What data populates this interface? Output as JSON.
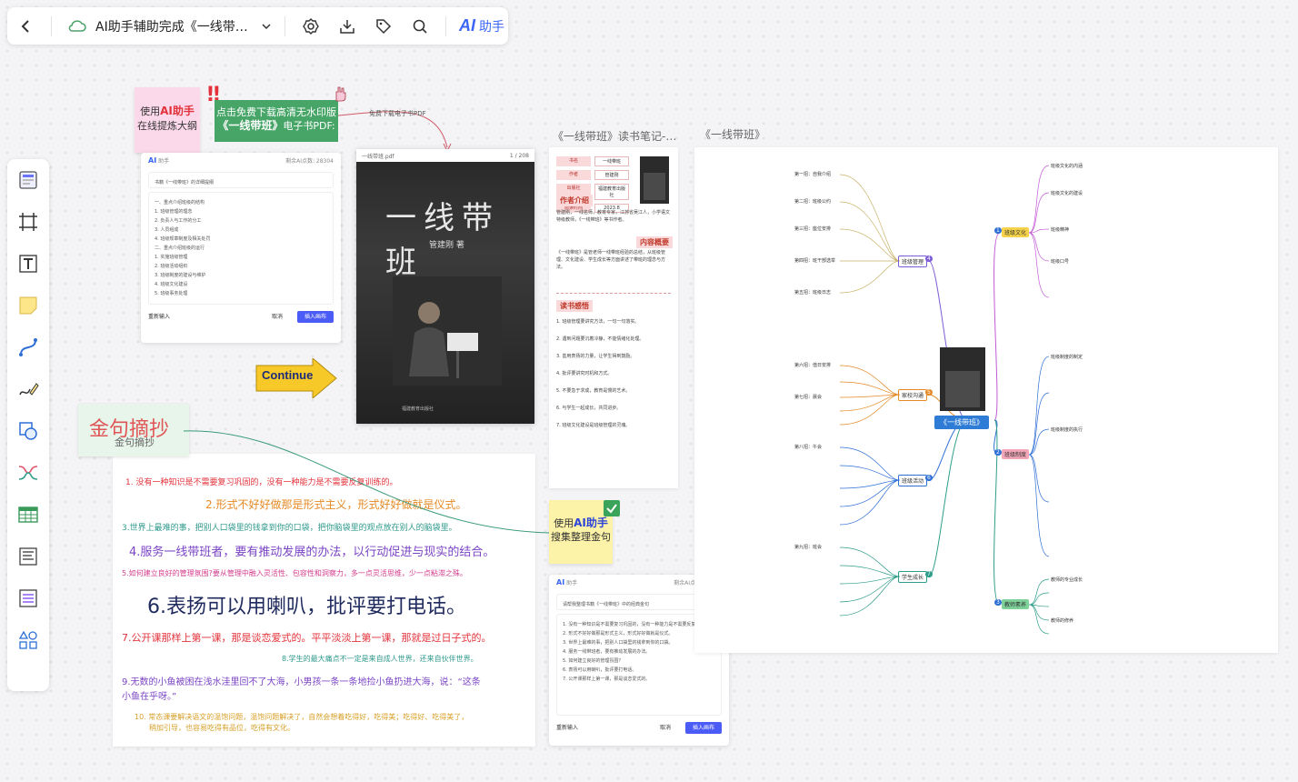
{
  "topbar": {
    "title": "AI助手辅助完成《一线带…",
    "ai_logo": "AI",
    "ai_label": "助手"
  },
  "stickies": {
    "pink_line1_prefix": "使用",
    "pink_line1_hl": "AI助手",
    "pink_line2": "在线提炼大纲",
    "green_line1": "点击免费下载高清无水印版",
    "green_line2_hl": "《一线带班》",
    "green_line2_suffix": "电子书PDF:",
    "yellow_line1_prefix": "使用",
    "yellow_line1_hl": "AI助手",
    "yellow_line2": "搜集整理金句"
  },
  "arrow_label": "免费下载电子书PDF",
  "dialog1": {
    "ai": "AI",
    "name": "助手",
    "quota": "剩余AI点数: 28304",
    "prompt": "书籍《一线带班》的详细提纲",
    "lines": [
      "一、重点介绍班级的结构",
      "1. 班级管理的理念",
      "2. 负责人与工作的分工",
      "3. 人员组成",
      "4. 班级规章制度及相关处罚",
      "二、重点介绍班级的运行",
      "1. 实施班级管理",
      "2. 班级活动组织",
      "3. 班级制度的建设与维护",
      "4. 班级文化建设",
      "5. 班级事务处理"
    ],
    "regen": "重新输入",
    "cancel": "取消",
    "insert": "插入画布"
  },
  "dialog2": {
    "ai": "AI",
    "name": "助手",
    "quota": "剩余AI点数: 27652",
    "prompt": "请帮我整理书籍《一线带班》中的经典金句",
    "lines": [
      "1. 没有一种知识是不需要复习巩固的，没有一种能力是不需要反复训练的。",
      "2. 形式不好好做那是形式主义，形式好好做就是仪式。",
      "3. 世界上最难的事，把别人口袋里的钱拿到你的口袋。",
      "4. 服务一线带班者，要有推动发展的办法。",
      "5. 如何建立良好的管理氛围？",
      "6. 表扬可以用喇叭，批评要打电话。",
      "7. 公开课那样上第一课，那是谈恋爱式的。"
    ],
    "regen": "重新输入",
    "cancel": "取消",
    "insert": "插入画布"
  },
  "book": {
    "header_left": "一线带班.pdf",
    "page": "1 / 208",
    "title": "一线带班",
    "author": "管建刚 著",
    "publisher": "福建教育出版社"
  },
  "continue_label": "Continue",
  "quote_title": "金句摘抄",
  "quote_subtitle": "金句摘抄",
  "quotes": [
    {
      "text": "1. 没有一种知识是不需要复习巩固的，没有一种能力是不需要反复训练的。",
      "color": "#e3323b",
      "size": 9
    },
    {
      "text": "2.形式不好好做那是形式主义，形式好好做就是仪式。",
      "color": "#e58a26",
      "size": 12
    },
    {
      "text": "3.世界上最难的事，把别人口袋里的钱拿到你的口袋，把你脑袋里的观点放在别人的脑袋里。",
      "color": "#2f9a8d",
      "size": 9
    },
    {
      "text": "4.服务一线带班者，要有推动发展的办法，以行动促进与现实的结合。",
      "color": "#7b44c5",
      "size": 13
    },
    {
      "text": "5.如何建立良好的管理氛围?要从管理中融入灵活性、包容性和洞察力，多一点灵活思维，少一点粘滞之殊。",
      "color": "#d43c8c",
      "size": 8
    },
    {
      "text": "6.表扬可以用喇叭，批评要打电话。",
      "color": "#1f2a5e",
      "size": 22
    },
    {
      "text": "7.公开课那样上第一课，那是谈恋爱式的。平平淡淡上第一课，那就是过日子式的。",
      "color": "#e3323b",
      "size": 11
    },
    {
      "text": "8.学生的最大痛点不一定是来自成人世界，还来自伙伴世界。",
      "color": "#2f9a8d",
      "size": 8
    },
    {
      "text": "9.无数的小鱼被困在浅水洼里回不了大海，小男孩一条一条地捡小鱼扔进大海，说：“这条",
      "color": "#7b44c5",
      "size": 10
    },
    {
      "text": "小鱼在乎呀。”",
      "color": "#7b44c5",
      "size": 10
    },
    {
      "text": "10. 常态课要解决语文的温饱问题，温饱问题解决了，自然会想着吃得好，吃得美；吃得好、吃得美了，",
      "color": "#d8a02a",
      "size": 8
    },
    {
      "text": "稍加引导，也容易吃得有品位，吃得有文化。",
      "color": "#d8a02a",
      "size": 8
    }
  ],
  "notes": {
    "label": "《一线带班》读书笔记-…",
    "meta": [
      {
        "k": "书名",
        "v": "一线带班"
      },
      {
        "k": "作者",
        "v": "管建刚"
      },
      {
        "k": "出版社",
        "v": "福建教育出版社"
      },
      {
        "k": "阅读时间",
        "v": "2023.8"
      }
    ],
    "sec_author": "作者介绍",
    "author_text": "管建刚，一线名师，教育专家，江苏省吴江人，小学语文特级教师，《一线带班》等书作者。",
    "sec_summary": "内容概要",
    "summary_text": "《一线带班》是管老师一线带班经验的总结，从班级管理、文化建设、学生成长等方面讲述了带班的理念与方法。",
    "sec_insight": "读书感悟",
    "insights": [
      "1. 班级管理要讲究方法，一句一句落实。",
      "2. 遇到问题要沉着冷静，不能情绪化处理。",
      "3. 善用表扬的力量，让学生得到鼓励。",
      "4. 批评要讲究时机和方式。",
      "5. 不要急于求成，教育是慢的艺术。",
      "6. 与学生一起成长，共同进步。",
      "7. 班级文化建设是班级管理的灵魂。"
    ]
  },
  "mindmap": {
    "label": "《一线带班》",
    "root": "《一线带班》",
    "left_branches": [
      "班级管理",
      "家校沟通",
      "班级活动",
      "学生成长"
    ],
    "right_branches": [
      "班级文化",
      "班级制度",
      "教师素养"
    ],
    "left_badges": [
      "4",
      "5",
      "6",
      "7"
    ],
    "right_badges": [
      "1",
      "2",
      "3"
    ],
    "leaves_left": [
      "第一招：自我介绍",
      "第二招：班级公约",
      "第三招：座位安排",
      "第四招：班干部选举",
      "第五招：班级日志",
      "第六招：值日安排",
      "第七招：晨会",
      "第八招：午会",
      "第九招：班会"
    ],
    "leaves_right": [
      "班级文化的内涵",
      "班级文化的建设",
      "班级精神",
      "班级口号",
      "班级制度的制定",
      "班级制度的执行",
      "教师的专业成长",
      "教师的修养"
    ]
  },
  "colors": {
    "accent": "#3b66f5",
    "green_sticky": "#46a567",
    "pink_sticky": "#fbd9ea",
    "yellow_sticky": "#fdf3a8",
    "continue_yellow": "#f7c928"
  }
}
